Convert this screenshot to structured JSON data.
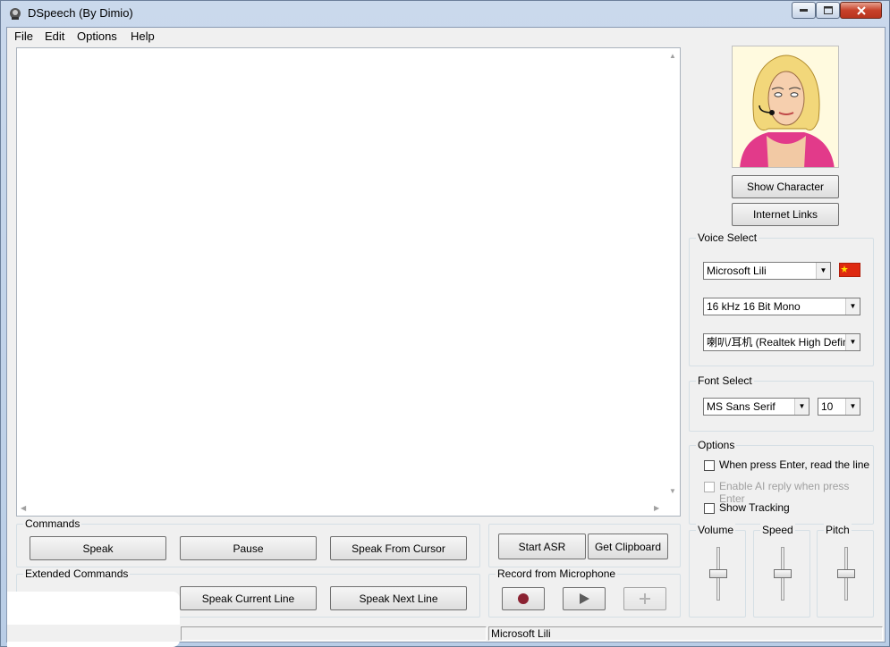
{
  "window": {
    "title": "DSpeech (By Dimio)"
  },
  "menu": [
    "File",
    "Edit",
    "Options",
    "Help"
  ],
  "character": {
    "show_button": "Show Character",
    "links_button": "Internet Links"
  },
  "voice_select": {
    "label": "Voice Select",
    "voice": "Microsoft Lili",
    "format": "16 kHz 16 Bit Mono",
    "device": "喇叭/耳机 (Realtek High Definition",
    "flag_color": "#de2910"
  },
  "font_select": {
    "label": "Font Select",
    "font": "MS Sans Serif",
    "size": "10"
  },
  "options": {
    "label": "Options",
    "items": [
      {
        "label": "When press Enter, read the line",
        "checked": false,
        "enabled": true
      },
      {
        "label": "Enable AI reply when press Enter",
        "checked": false,
        "enabled": false
      },
      {
        "label": "Show Tracking",
        "checked": false,
        "enabled": true
      }
    ]
  },
  "sliders": {
    "volume": {
      "label": "Volume",
      "level": 0.5
    },
    "speed": {
      "label": "Speed",
      "level": 0.5
    },
    "pitch": {
      "label": "Pitch",
      "level": 0.5
    }
  },
  "commands": {
    "label": "Commands",
    "speak": "Speak",
    "pause": "Pause",
    "speak_from_cursor": "Speak From Cursor"
  },
  "extended_commands": {
    "label": "Extended Commands",
    "speak_current_line": "Speak Current Line",
    "speak_next_line": "Speak Next Line"
  },
  "asr": {
    "start_asr": "Start ASR",
    "get_clipboard": "Get Clipboard"
  },
  "record": {
    "label": "Record from Microphone"
  },
  "status": {
    "voice": "Microsoft Lili"
  }
}
